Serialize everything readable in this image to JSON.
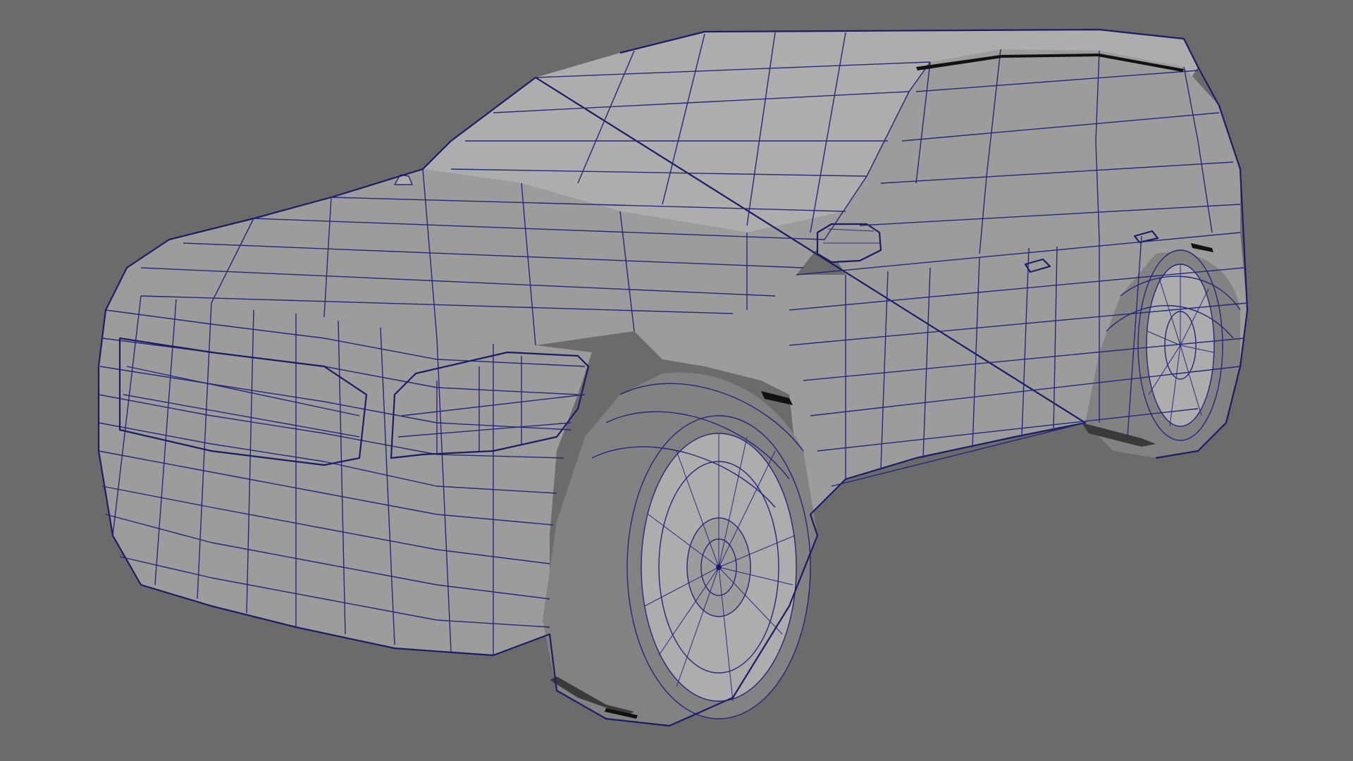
{
  "viewport": {
    "background": "#6b6b6b",
    "wire_color": "#26267a",
    "surface_color": "#9c9c9c",
    "display_mode": "wireframe-on-shaded"
  },
  "model": {
    "subject": "suv-car-mesh"
  }
}
